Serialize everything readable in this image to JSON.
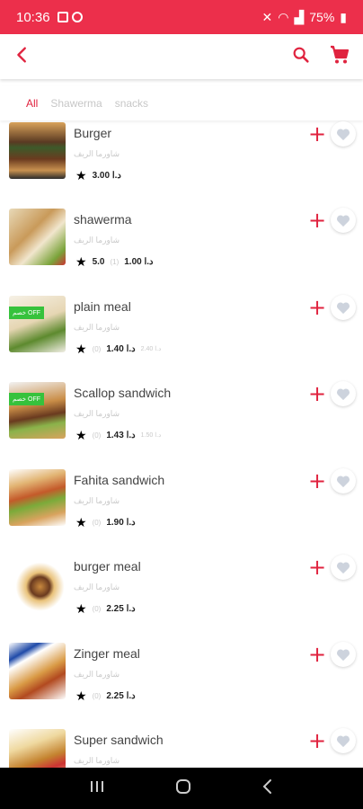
{
  "status": {
    "time": "10:36",
    "battery": "75%"
  },
  "colors": {
    "accent": "#e0233f",
    "status_bar": "#ec2f4b"
  },
  "tabs": [
    {
      "label": "All"
    },
    {
      "label": "Shawerma"
    },
    {
      "label": "snacks"
    }
  ],
  "items": [
    {
      "name": "Burger",
      "sub": "شاورما الريف",
      "rating": "",
      "count": "",
      "price": "3.00 د.ا",
      "old_price": "",
      "badge": ""
    },
    {
      "name": "shawerma",
      "sub": "شاورما الريف",
      "rating": "5.0",
      "count": "(1)",
      "price": "1.00 د.ا",
      "old_price": "",
      "badge": ""
    },
    {
      "name": "plain meal",
      "sub": "شاورما الريف",
      "rating": "",
      "count": "(0)",
      "price": "1.40 د.ا",
      "old_price": "2.40 د.ا",
      "badge": "خصم OFF"
    },
    {
      "name": "Scallop sandwich",
      "sub": "شاورما الريف",
      "rating": "",
      "count": "(0)",
      "price": "1.43 د.ا",
      "old_price": "1.50 د.ا",
      "badge": "خصم OFF"
    },
    {
      "name": "Fahita sandwich",
      "sub": "شاورما الريف",
      "rating": "",
      "count": "(0)",
      "price": "1.90 د.ا",
      "old_price": "",
      "badge": ""
    },
    {
      "name": "burger meal",
      "sub": "شاورما الريف",
      "rating": "",
      "count": "(0)",
      "price": "2.25 د.ا",
      "old_price": "",
      "badge": ""
    },
    {
      "name": "Zinger meal",
      "sub": "شاورما الريف",
      "rating": "",
      "count": "(0)",
      "price": "2.25 د.ا",
      "old_price": "",
      "badge": ""
    },
    {
      "name": "Super sandwich",
      "sub": "شاورما الريف",
      "rating": "",
      "count": "",
      "price": "",
      "old_price": "",
      "badge": ""
    }
  ]
}
